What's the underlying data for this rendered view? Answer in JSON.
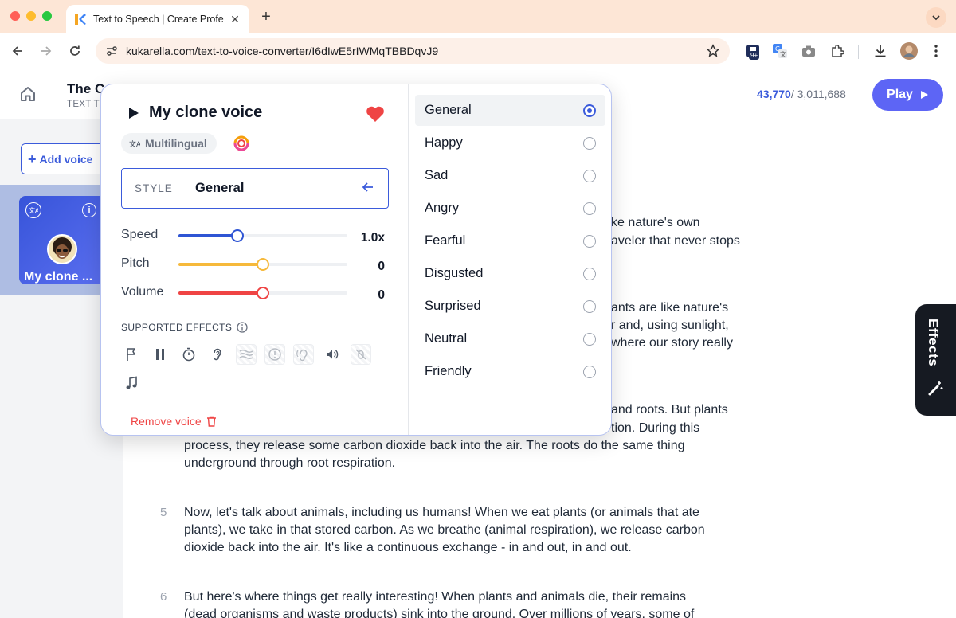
{
  "browser": {
    "tab_title": "Text to Speech | Create Profe",
    "url": "kukarella.com/text-to-voice-converter/I6dIwE5rIWMqTBBDqvJ9",
    "extension_badge": "9+"
  },
  "header": {
    "doc_title": "The Ca",
    "doc_subtitle": "TEXT T",
    "counter_used": "43,770",
    "counter_total": "/ 3,011,688",
    "play_label": "Play"
  },
  "sidebar": {
    "add_voice_label": "Add voice",
    "voice_card_name": "My clone ...",
    "voice_card_info": "i"
  },
  "effects_tab": {
    "label": "Effects"
  },
  "popup": {
    "voice_title": "My clone voice",
    "language_chip": "Multilingual",
    "style_label": "STYLE",
    "style_value": "General",
    "sliders": [
      {
        "label": "Speed",
        "value_text": "1.0x",
        "fraction": 0.35,
        "color": "#2f55d4"
      },
      {
        "label": "Pitch",
        "value_text": "0",
        "fraction": 0.5,
        "color": "#f6b93b"
      },
      {
        "label": "Volume",
        "value_text": "0",
        "fraction": 0.5,
        "color": "#ef4444"
      }
    ],
    "supported_effects_label": "SUPPORTED EFFECTS",
    "remove_voice_label": "Remove voice",
    "style_options": [
      {
        "label": "General",
        "selected": true
      },
      {
        "label": "Happy",
        "selected": false
      },
      {
        "label": "Sad",
        "selected": false
      },
      {
        "label": "Angry",
        "selected": false
      },
      {
        "label": "Fearful",
        "selected": false
      },
      {
        "label": "Disgusted",
        "selected": false
      },
      {
        "label": "Surprised",
        "selected": false
      },
      {
        "label": "Neutral",
        "selected": false
      },
      {
        "label": "Friendly",
        "selected": false
      }
    ]
  },
  "document": {
    "p1_line1": "ke nature's own",
    "p1_line2": "aveler that never stops",
    "p2_line1": "ants are like nature's",
    "p2_line2": "r and, using sunlight,",
    "p2_line3": "where our story really",
    "p3_line1": "and roots. But plants",
    "p3_line2": "tion. During this",
    "p3_line3": "process, they release some carbon dioxide back into the air. The roots do the same thing",
    "p3_line4": "underground through root respiration.",
    "p5_num": "5",
    "p5_line1": "Now, let's talk about animals, including us humans! When we eat plants (or animals that ate",
    "p5_line2": "plants), we take in that stored carbon. As we breathe (animal respiration), we release carbon",
    "p5_line3": "dioxide back into the air. It's like a continuous exchange - in and out, in and out.",
    "p6_num": "6",
    "p6_line1": "But here's where things get really interesting! When plants and animals die, their remains",
    "p6_line2": "(dead organisms and waste products) sink into the ground. Over millions of years, some of"
  }
}
